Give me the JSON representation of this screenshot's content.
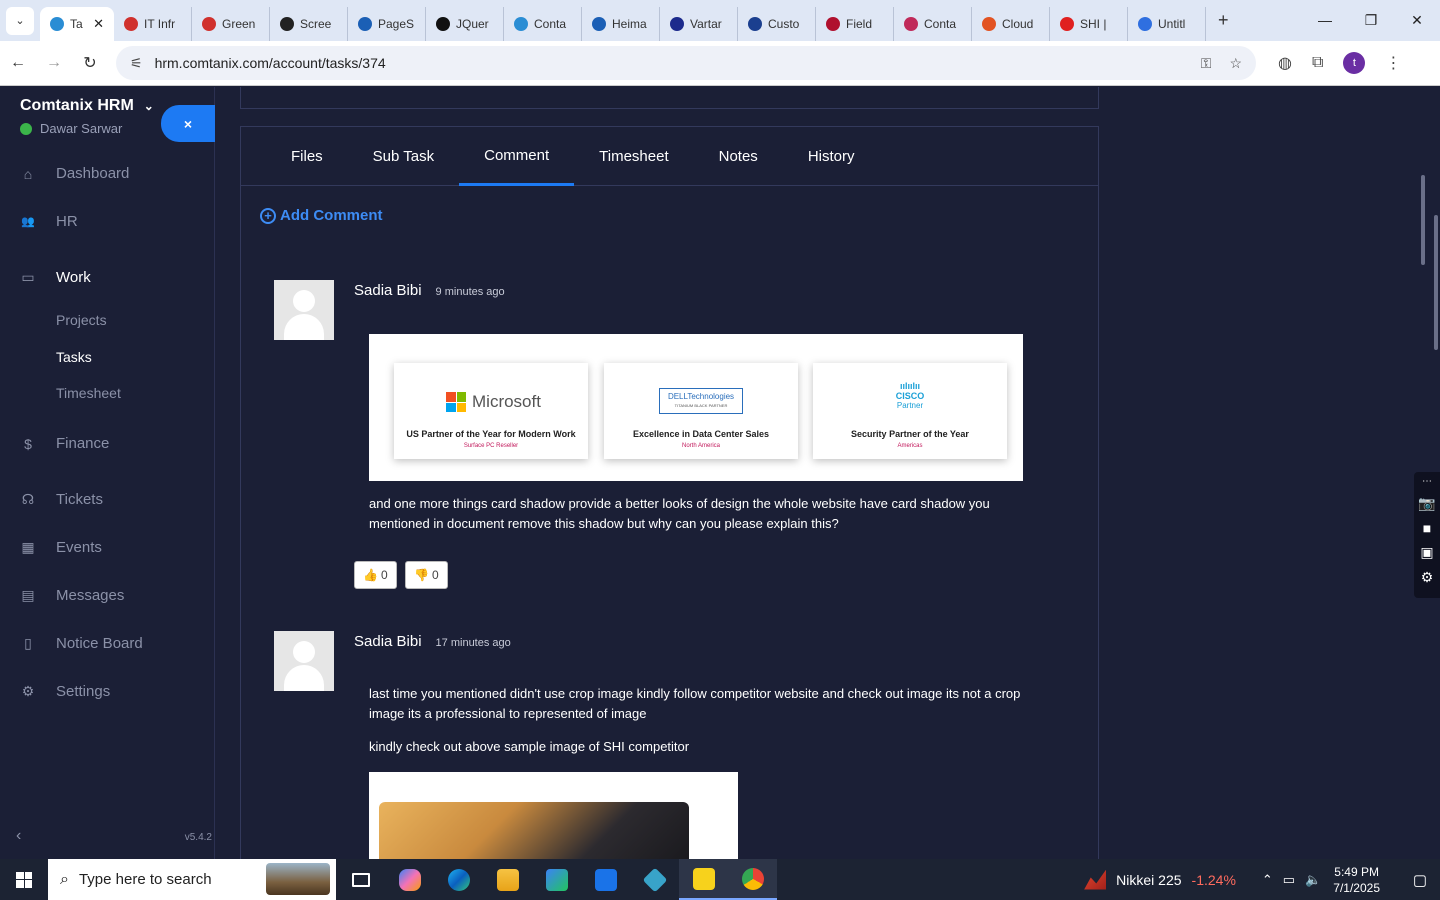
{
  "browser": {
    "tabs": [
      {
        "label": "Ta",
        "color": "#2a8dd4",
        "active": true
      },
      {
        "label": "IT Infr",
        "color": "#d0312d"
      },
      {
        "label": "Green",
        "color": "#d0312d"
      },
      {
        "label": "Scree",
        "color": "#222222"
      },
      {
        "label": "PageS",
        "color": "#1b5fb5"
      },
      {
        "label": "JQuer",
        "color": "#111111"
      },
      {
        "label": "Conta",
        "color": "#2a8dd4"
      },
      {
        "label": "Heima",
        "color": "#1b5fb5"
      },
      {
        "label": "Vartar",
        "color": "#1c2a8c"
      },
      {
        "label": "Custo",
        "color": "#1b3f8f"
      },
      {
        "label": "Field",
        "color": "#b0102e"
      },
      {
        "label": "Conta",
        "color": "#c02a5a"
      },
      {
        "label": "Cloud",
        "color": "#e25322"
      },
      {
        "label": "SHI |",
        "color": "#e02020"
      },
      {
        "label": "Untitl",
        "color": "#2f6fe0"
      }
    ],
    "url": "hrm.comtanix.com/account/tasks/374",
    "profile_initial": "t"
  },
  "sidebar": {
    "brand": "Comtanix HRM",
    "user": "Dawar Sarwar",
    "close_label": "×",
    "menu": [
      {
        "label": "Dashboard",
        "icon": "⌂"
      },
      {
        "label": "HR",
        "icon": "👥"
      },
      {
        "label": "Work",
        "icon": "▭"
      },
      {
        "label": "Finance",
        "icon": "$"
      },
      {
        "label": "Tickets",
        "icon": "☊"
      },
      {
        "label": "Events",
        "icon": "▦"
      },
      {
        "label": "Messages",
        "icon": "▤"
      },
      {
        "label": "Notice Board",
        "icon": "▯"
      },
      {
        "label": "Settings",
        "icon": "⚙"
      }
    ],
    "submenu": [
      "Projects",
      "Tasks",
      "Timesheet"
    ],
    "version": "v5.4.2"
  },
  "task": {
    "tabs": [
      "Files",
      "Sub Task",
      "Comment",
      "Timesheet",
      "Notes",
      "History"
    ],
    "active_tab": "Comment",
    "add_comment": "Add Comment",
    "comments": [
      {
        "author": "Sadia Bibi",
        "time": "9 minutes ago",
        "text": "and one more things card shadow provide a better looks of design the whole website have card shadow you mentioned in document remove this shadow but why can you please explain this?",
        "likes": "0",
        "dislikes": "0",
        "image_cards": [
          {
            "logo": "Microsoft",
            "caption": "US Partner of the Year for Modern Work",
            "sub": "Surface PC Reseller"
          },
          {
            "logo": "DELLTechnologies",
            "logo_sub": "TITANIUM BLACK PARTNER",
            "caption": "Excellence in Data Center Sales",
            "sub": "North America"
          },
          {
            "logo": "CISCO",
            "logo_sub": "Partner",
            "caption": "Security Partner of the Year",
            "sub": "Americas"
          }
        ]
      },
      {
        "author": "Sadia Bibi",
        "time": "17 minutes ago",
        "text": "last time you mentioned didn't use crop image kindly follow competitor website and check out image its not a crop image its a professional to represented of image",
        "text2": "kindly check out above sample image of SHI competitor"
      }
    ]
  },
  "taskbar": {
    "search_placeholder": "Type here to search",
    "stock_name": "Nikkei 225",
    "stock_change": "-1.24%",
    "time": "5:49 PM",
    "date": "7/1/2025"
  }
}
